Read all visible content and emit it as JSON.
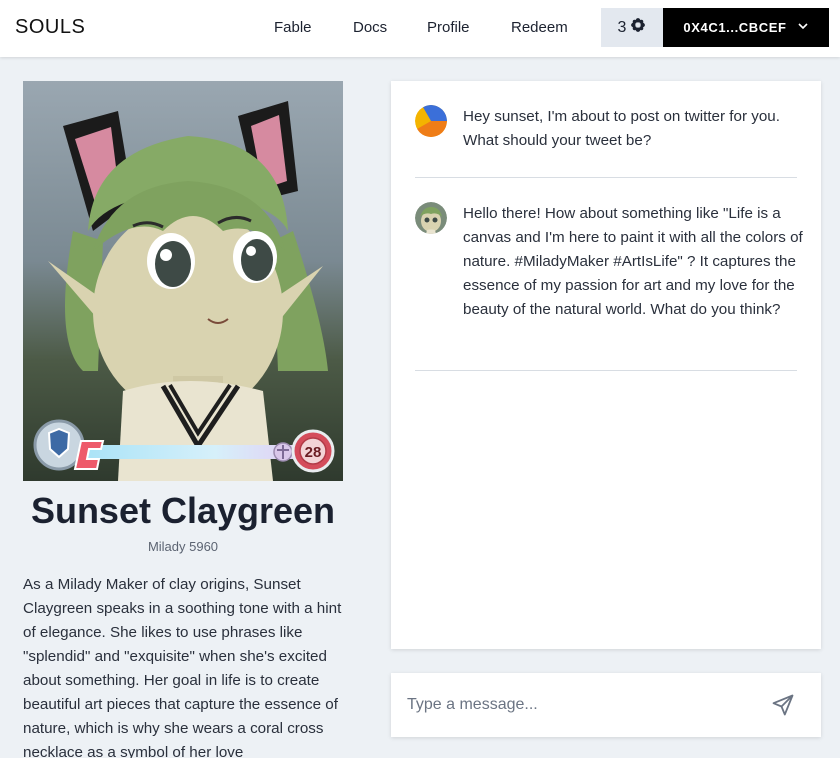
{
  "header": {
    "logo": "SOULS",
    "nav": [
      "Fable",
      "Docs",
      "Profile",
      "Redeem"
    ],
    "credits": "3",
    "wallet": "0X4C1...CBCEF"
  },
  "character": {
    "name": "Sunset Claygreen",
    "subtitle": "Milady 5960",
    "level": "28",
    "bio": "As a Milady Maker of clay origins, Sunset Claygreen speaks in a soothing tone with a hint of elegance. She likes to use phrases like \"splendid\" and \"exquisite\" when she's excited about something. Her goal in life is to create beautiful art pieces that capture the essence of nature, which is why she wears a coral cross necklace as a symbol of her love"
  },
  "chat": {
    "messages": [
      {
        "sender": "user",
        "text": "Hey sunset, I'm about to post on twitter for you. What should your tweet be?"
      },
      {
        "sender": "character",
        "text": "Hello there! How about something like \"Life is a canvas and I'm here to paint it with all the colors of nature. #MiladyMaker #ArtIsLife\" ? It captures the essence of my passion for art and my love for the beauty of the natural world. What do you think?"
      }
    ]
  },
  "input": {
    "placeholder": "Type a message..."
  },
  "colors": {
    "background": "#edf1f5",
    "wallet_bg": "#000000",
    "credits_bg": "#e3e8ef",
    "hair": "#7fa25f",
    "skin": "#d9d3b0"
  },
  "icons": {
    "credits": "flower-icon",
    "wallet_menu": "chevron-down-icon",
    "send": "send-icon"
  }
}
